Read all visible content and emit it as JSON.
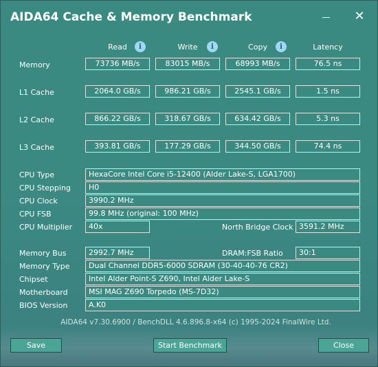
{
  "window": {
    "title": "AIDA64 Cache & Memory Benchmark",
    "minimize_glyph": "—",
    "close_glyph": "✕"
  },
  "columns": {
    "read": "Read",
    "write": "Write",
    "copy": "Copy",
    "latency": "Latency",
    "info_glyph": "i"
  },
  "rows": [
    {
      "label": "Memory",
      "read": "73736 MB/s",
      "write": "83015 MB/s",
      "copy": "68993 MB/s",
      "latency": "76.5 ns"
    },
    {
      "label": "L1 Cache",
      "read": "2064.0 GB/s",
      "write": "986.21 GB/s",
      "copy": "2545.1 GB/s",
      "latency": "1.5 ns"
    },
    {
      "label": "L2 Cache",
      "read": "866.22 GB/s",
      "write": "318.67 GB/s",
      "copy": "634.42 GB/s",
      "latency": "5.3 ns"
    },
    {
      "label": "L3 Cache",
      "read": "393.81 GB/s",
      "write": "177.29 GB/s",
      "copy": "344.50 GB/s",
      "latency": "74.4 ns"
    }
  ],
  "cpu": {
    "type_label": "CPU Type",
    "type_value": "HexaCore Intel Core i5-12400  (Alder Lake-S, LGA1700)",
    "stepping_label": "CPU Stepping",
    "stepping_value": "H0",
    "clock_label": "CPU Clock",
    "clock_value": "3990.2 MHz",
    "fsb_label": "CPU FSB",
    "fsb_value": "99.8 MHz  (original: 100 MHz)",
    "multiplier_label": "CPU Multiplier",
    "multiplier_value": "40x",
    "nb_clock_label": "North Bridge Clock",
    "nb_clock_value": "3591.2 MHz"
  },
  "system": {
    "membus_label": "Memory Bus",
    "membus_value": "2992.7 MHz",
    "ratio_label": "DRAM:FSB Ratio",
    "ratio_value": "30:1",
    "memtype_label": "Memory Type",
    "memtype_value": "Dual Channel DDR5-6000 SDRAM  (30-40-40-76 CR2)",
    "chipset_label": "Chipset",
    "chipset_value": "Intel Alder Point-S Z690, Intel Alder Lake-S",
    "mobo_label": "Motherboard",
    "mobo_value": "MSI MAG Z690 Torpedo (MS-7D32)",
    "bios_label": "BIOS Version",
    "bios_value": "A.K0"
  },
  "footer": {
    "text": "AIDA64 v7.30.6900 / BenchDLL 4.6.896.8-x64  (c) 1995-2024 FinalWire Ltd."
  },
  "buttons": {
    "save": "Save",
    "start": "Start Benchmark",
    "close": "Close"
  }
}
